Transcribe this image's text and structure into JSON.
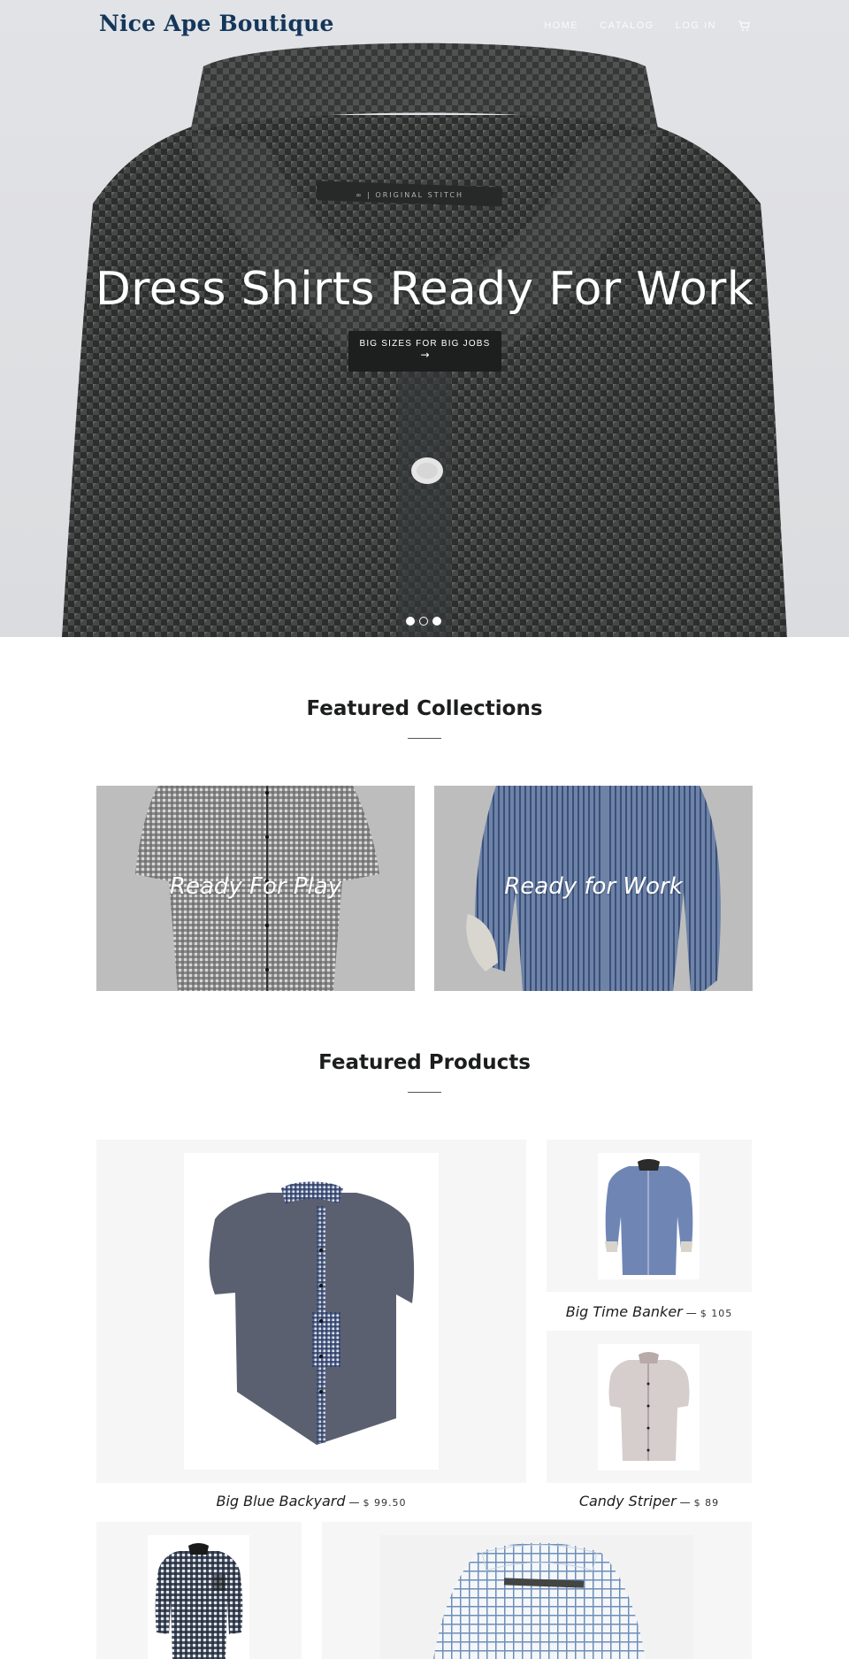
{
  "header": {
    "logo": "Nice Ape Boutique",
    "nav": [
      {
        "label": "Home"
      },
      {
        "label": "Catalog"
      },
      {
        "label": "Log in"
      }
    ]
  },
  "hero": {
    "title": "Dress Shirts Ready For Work",
    "button_label": "BIG SIZES FOR BIG JOBS",
    "button_arrow": "→",
    "slides": 3,
    "active_slide": 2
  },
  "featured_collections": {
    "title": "Featured Collections",
    "items": [
      {
        "label": "Ready For Play"
      },
      {
        "label": "Ready for Work"
      }
    ]
  },
  "featured_products": {
    "title": "Featured Products",
    "items": [
      {
        "name": "Big Blue Backyard",
        "price": "$ 99.50"
      },
      {
        "name": "Big Time Banker",
        "price": "$ 105"
      },
      {
        "name": "Candy Striper",
        "price": "$ 89"
      }
    ]
  },
  "colors": {
    "logo": "#14365a",
    "button_bg": "#1d1f1e",
    "collection_bg": "#bdbdbd",
    "card_bg": "#f6f6f6"
  }
}
